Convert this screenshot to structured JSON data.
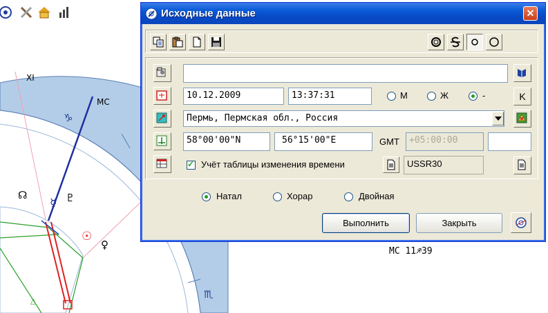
{
  "app_toolbar": {
    "icons": [
      "chart-wheel-icon",
      "tools-icon",
      "house-person-icon",
      "chart-bars-person-icon"
    ]
  },
  "chart": {
    "labels": {
      "xi": "XI",
      "mc": "MC",
      "capricorn_glyph": "♑",
      "scorpio_glyph": "♏",
      "north_node": "☊",
      "mercury": "☿",
      "pluto": "♇",
      "sun": "☉",
      "venus": "♀",
      "triangle": "△"
    },
    "mc_readout": "MC  11♐39"
  },
  "dialog": {
    "title": "Исходные данные",
    "close_glyph": "✕",
    "toolbar_left_icons": [
      "copy-icon",
      "paste-icon",
      "new-document-icon",
      "save-disk-icon"
    ],
    "toolbar_right_icons": [
      "ring-icon",
      "strike-s-icon",
      "small-circle-icon",
      "circle-icon"
    ],
    "name_field": {
      "value": ""
    },
    "date_field": {
      "value": "10.12.2009"
    },
    "time_field": {
      "value": "13:37:31"
    },
    "gender": {
      "options": [
        {
          "label": "М",
          "selected": false
        },
        {
          "label": "Ж",
          "selected": false
        },
        {
          "label": "-",
          "selected": true
        }
      ]
    },
    "k_button_label": "K",
    "location_field": {
      "value": "Пермь, Пермская обл., Россия"
    },
    "latitude_field": {
      "value": "58°00'00\"N"
    },
    "longitude_field": {
      "value": "56°15'00\"E"
    },
    "gmt_label": "GMT",
    "gmt_field": {
      "value": "+05:00:00"
    },
    "extra_field": {
      "value": ""
    },
    "time_table_checkbox": {
      "label": "Учёт таблицы изменения времени",
      "checked": true
    },
    "timezone_table_field": {
      "value": "USSR30"
    },
    "chart_type": {
      "options": [
        {
          "label": "Натал",
          "selected": true
        },
        {
          "label": "Хорар",
          "selected": false
        },
        {
          "label": "Двойная",
          "selected": false
        }
      ]
    },
    "execute_button": "Выполнить",
    "close_button": "Закрыть",
    "colors": {
      "title_blue": "#0a5bd6",
      "dialog_bg": "#ece9d8",
      "close_red": "#d6522f"
    }
  }
}
